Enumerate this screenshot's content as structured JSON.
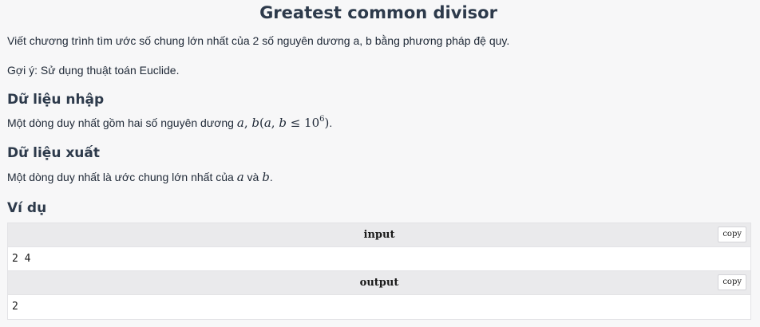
{
  "problem": {
    "title": "Greatest common divisor",
    "statement": "Viết chương trình tìm ước số chung lớn nhất của 2 số nguyên dương a, b bằng phương pháp đệ quy.",
    "hint": "Gợi ý: Sử dụng thuật toán Euclide."
  },
  "input_section": {
    "heading": "Dữ liệu nhập",
    "text_before": "Một dòng duy nhất gồm hai số nguyên dương ",
    "math_a": "a",
    "math_comma": ", ",
    "math_b": "b",
    "math_open": "(",
    "math_a2": "a",
    "math_comma2": ", ",
    "math_b2": "b",
    "math_le": " ≤ ",
    "math_base": "10",
    "math_exp": "6",
    "math_close": ")",
    "text_after": "."
  },
  "output_section": {
    "heading": "Dữ liệu xuất",
    "text_before": "Một dòng duy nhất là ước chung lớn nhất của ",
    "math_a": "a",
    "text_middle": " và ",
    "math_b": "b",
    "text_after": "."
  },
  "example": {
    "heading": "Ví dụ",
    "input_label": "input",
    "input_value": "2 4",
    "output_label": "output",
    "output_value": "2",
    "copy_label": "copy"
  }
}
